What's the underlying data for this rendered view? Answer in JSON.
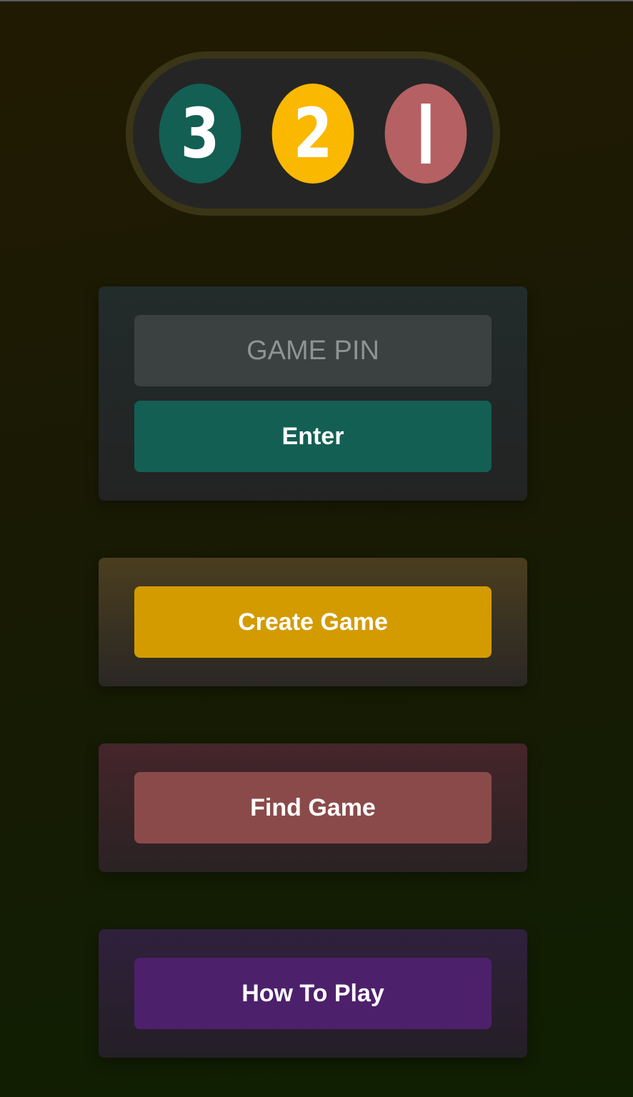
{
  "logo": {
    "digits": [
      {
        "label": "3",
        "color": "#135f54"
      },
      {
        "label": "2",
        "color": "#fbb800"
      },
      {
        "label": "1",
        "color": "#b56062"
      }
    ]
  },
  "join": {
    "pin_placeholder": "GAME PIN",
    "pin_value": "",
    "enter_label": "Enter"
  },
  "create": {
    "label": "Create Game"
  },
  "find": {
    "label": "Find Game"
  },
  "howto": {
    "label": "How To Play"
  },
  "colors": {
    "enter": "#135f54",
    "create": "#d49b00",
    "find": "#8b4a4a",
    "howto": "#4d206b"
  }
}
